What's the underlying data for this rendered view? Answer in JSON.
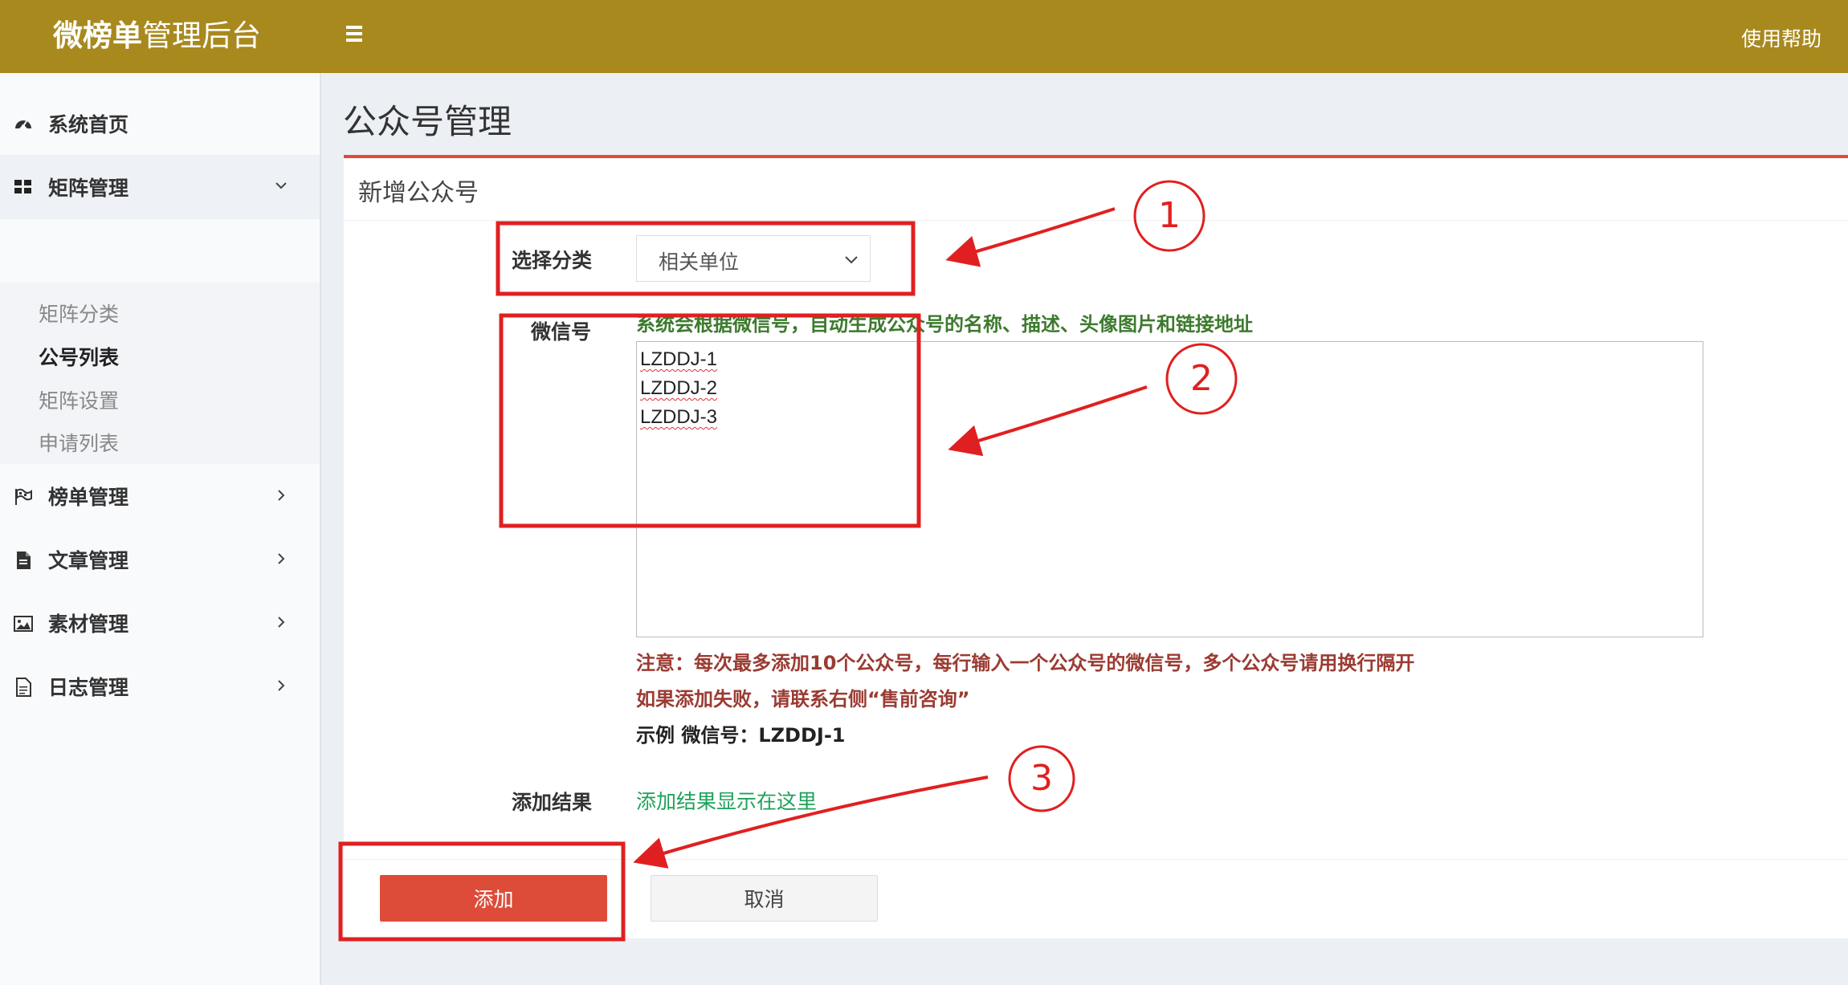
{
  "header": {
    "logo_bold": "微榜单",
    "logo_rest": "管理后台",
    "help": "使用帮助"
  },
  "sidebar": {
    "items": [
      {
        "label": "系统首页",
        "icon": "dashboard-icon"
      },
      {
        "label": "矩阵管理",
        "icon": "grid-icon",
        "expanded": true
      },
      {
        "label": "榜单管理",
        "icon": "flag-icon"
      },
      {
        "label": "文章管理",
        "icon": "document-icon"
      },
      {
        "label": "素材管理",
        "icon": "image-icon"
      },
      {
        "label": "日志管理",
        "icon": "log-icon"
      }
    ],
    "submenu": [
      {
        "label": "矩阵分类"
      },
      {
        "label": "公号列表",
        "active": true
      },
      {
        "label": "矩阵设置"
      },
      {
        "label": "申请列表"
      }
    ]
  },
  "page": {
    "title": "公众号管理",
    "card_title": "新增公众号"
  },
  "form": {
    "category_label": "选择分类",
    "category_value": "相关单位",
    "wechat_label": "微信号",
    "wechat_hint": "系统会根据微信号，自动生成公众号的名称、描述、头像图片和链接地址",
    "wechat_lines": [
      "LZDDJ-1",
      "LZDDJ-2",
      "LZDDJ-3"
    ],
    "note1": "注意：每次最多添加10个公众号，每行输入一个公众号的微信号，多个公众号请用换行隔开",
    "note2": "如果添加失败，请联系右侧“售前咨询”",
    "example": "示例 微信号：LZDDJ-1",
    "result_label": "添加结果",
    "result_value": "添加结果显示在这里",
    "add_button": "添加",
    "cancel_button": "取消"
  },
  "annotations": {
    "step1": "1",
    "step2": "2",
    "step3": "3",
    "color": "#e02020"
  },
  "colors": {
    "header": "#a8891e",
    "accent_red": "#dd4b39",
    "hint_green": "#3d7a2e",
    "note_red": "#9b3b32",
    "result_green": "#1fa15a"
  }
}
